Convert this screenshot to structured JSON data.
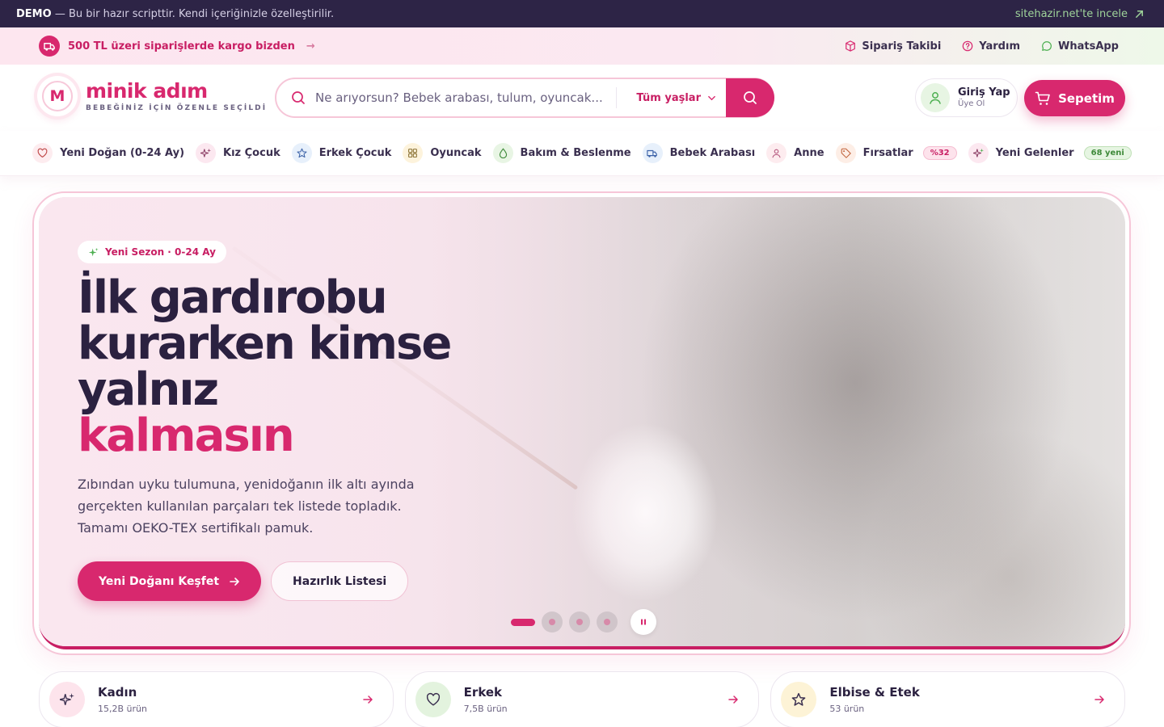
{
  "demo_bar": {
    "label": "DEMO",
    "text": "— Bu bir hazır scripttir. Kendi içeriğinizle özelleştirilir.",
    "link": "sitehazir.net'te incele"
  },
  "promo": {
    "shipping_text": "500 TL üzeri siparişlerde kargo bizden",
    "links": [
      "Sipariş Takibi",
      "Yardım",
      "WhatsApp"
    ]
  },
  "header": {
    "logo_letter": "M",
    "logo_name": "minik adım",
    "logo_tagline": "BEBEĞİNİZ İÇİN ÖZENLE SEÇİLDİ",
    "search_placeholder": "Ne arıyorsun? Bebek arabası, tulum, oyuncak...",
    "age_filter": "Tüm yaşlar",
    "login_title": "Giriş Yap",
    "login_sub": "Üye Ol",
    "cart_label": "Sepetim"
  },
  "nav": {
    "items": [
      {
        "label": "Yeni Doğan (0-24 Ay)",
        "icon": "heart-icon"
      },
      {
        "label": "Kız Çocuk",
        "icon": "sparkle-icon"
      },
      {
        "label": "Erkek Çocuk",
        "icon": "star-icon"
      },
      {
        "label": "Oyuncak",
        "icon": "grid-icon"
      },
      {
        "label": "Bakım & Beslenme",
        "icon": "drop-icon"
      },
      {
        "label": "Bebek Arabası",
        "icon": "truck-icon"
      },
      {
        "label": "Anne",
        "icon": "user-icon"
      },
      {
        "label": "Fırsatlar",
        "icon": "tag-icon",
        "badge": "%32"
      },
      {
        "label": "Yeni Gelenler",
        "icon": "sparkle-icon",
        "badge": "68 yeni"
      }
    ]
  },
  "hero": {
    "pill": "Yeni Sezon · 0-24 Ay",
    "title_line1": "İlk gardırobu",
    "title_line2": "kurarken kimse",
    "title_line3": "yalnız",
    "title_accent": "kalmasın",
    "text_line1": "Zıbından uyku tulumuna, yenidoğanın ilk altı ayında",
    "text_line2": "gerçekten kullanılan parçaları tek listede topladık.",
    "text_line3": "Tamamı OEKO-TEX sertifikalı pamuk.",
    "primary_cta": "Yeni Doğanı Keşfet",
    "secondary_cta": "Hazırlık Listesi",
    "slide_count": 4,
    "active_slide": 1
  },
  "categories": [
    {
      "name": "Kadın",
      "count": "15,2B ürün",
      "icon": "sparkle-icon"
    },
    {
      "name": "Erkek",
      "count": "7,5B ürün",
      "icon": "heart-icon"
    },
    {
      "name": "Elbise & Etek",
      "count": "53 ürün",
      "icon": "star-icon"
    }
  ],
  "colors": {
    "brand": "#d8286e",
    "dark": "#2d2446",
    "accent_green": "#4caf50"
  }
}
